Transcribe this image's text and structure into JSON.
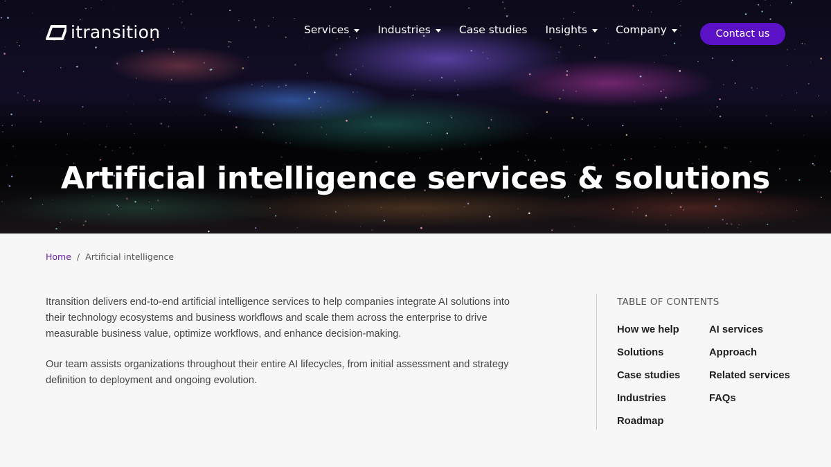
{
  "brand": {
    "logo_text": "itransition",
    "accent": "#5b12c7",
    "link_color": "#6b21a8"
  },
  "nav": {
    "items": [
      {
        "label": "Services",
        "has_dropdown": true
      },
      {
        "label": "Industries",
        "has_dropdown": true
      },
      {
        "label": "Case studies",
        "has_dropdown": false
      },
      {
        "label": "Insights",
        "has_dropdown": true
      },
      {
        "label": "Company",
        "has_dropdown": true
      }
    ],
    "contact_label": "Contact us"
  },
  "hero": {
    "title": "Artificial intelligence services & solutions"
  },
  "breadcrumb": {
    "home": "Home",
    "separator": "/",
    "current": "Artificial intelligence"
  },
  "intro": {
    "paragraphs": [
      "Itransition delivers end-to-end artificial intelligence services to help companies integrate AI solutions into their technology ecosystems and business workflows and scale them across the enterprise to drive measurable business value, optimize workflows, and enhance decision-making.",
      "Our team assists organizations throughout their entire AI lifecycles, from initial assessment and strategy definition to deployment and ongoing evolution."
    ]
  },
  "toc": {
    "title": "TABLE OF CONTENTS",
    "column1": [
      "How we help",
      "Solutions",
      "Case studies",
      "Industries",
      "Roadmap"
    ],
    "column2": [
      "AI services",
      "Approach",
      "Related services",
      "FAQs"
    ]
  }
}
